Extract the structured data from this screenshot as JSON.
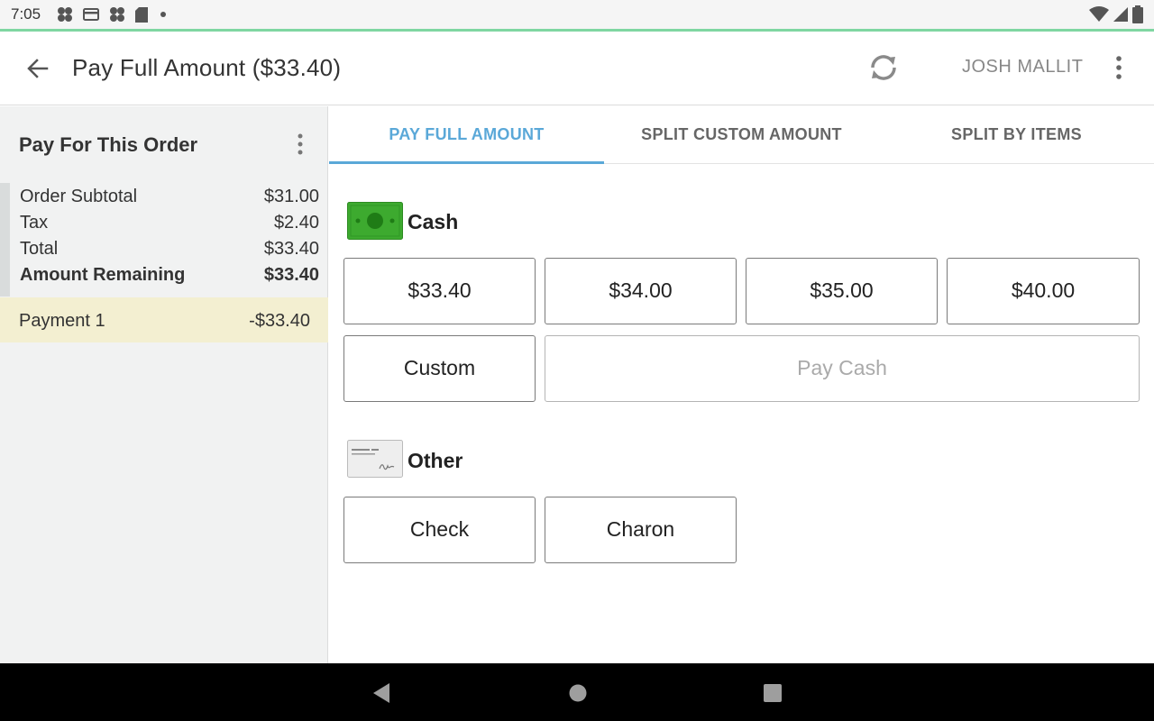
{
  "status_bar": {
    "time": "7:05",
    "icons": [
      "pinwheel-icon",
      "card-icon",
      "pinwheel-icon",
      "sd-card-icon",
      "dot-icon"
    ],
    "right_icons": [
      "wifi-icon",
      "signal-icon",
      "battery-icon"
    ]
  },
  "colors": {
    "accent_line": "#7fd6a1",
    "tab_active": "#5aa8d8",
    "payment_highlight": "#f3efd1",
    "cash_green": "#3daa2f"
  },
  "app_bar": {
    "title": "Pay Full Amount ($33.40)",
    "user_name": "JOSH MALLIT",
    "icons": [
      "back-arrow-icon",
      "refresh-icon",
      "more-vert-icon"
    ]
  },
  "order_panel": {
    "heading": "Pay For This Order",
    "rows": [
      {
        "label": "Order Subtotal",
        "value": "$31.00"
      },
      {
        "label": "Tax",
        "value": "$2.40"
      },
      {
        "label": "Total",
        "value": "$33.40"
      },
      {
        "label": "Amount Remaining",
        "value": "$33.40"
      }
    ],
    "payment": {
      "label": "Payment 1",
      "value": "-$33.40"
    }
  },
  "tabs": [
    {
      "label": "PAY FULL AMOUNT",
      "active": true
    },
    {
      "label": "SPLIT CUSTOM AMOUNT",
      "active": false
    },
    {
      "label": "SPLIT BY ITEMS",
      "active": false
    }
  ],
  "cash": {
    "title": "Cash",
    "amounts": [
      "$33.40",
      "$34.00",
      "$35.00",
      "$40.00"
    ],
    "custom_label": "Custom",
    "pay_label": "Pay Cash"
  },
  "other": {
    "title": "Other",
    "methods": [
      "Check",
      "Charon"
    ]
  }
}
